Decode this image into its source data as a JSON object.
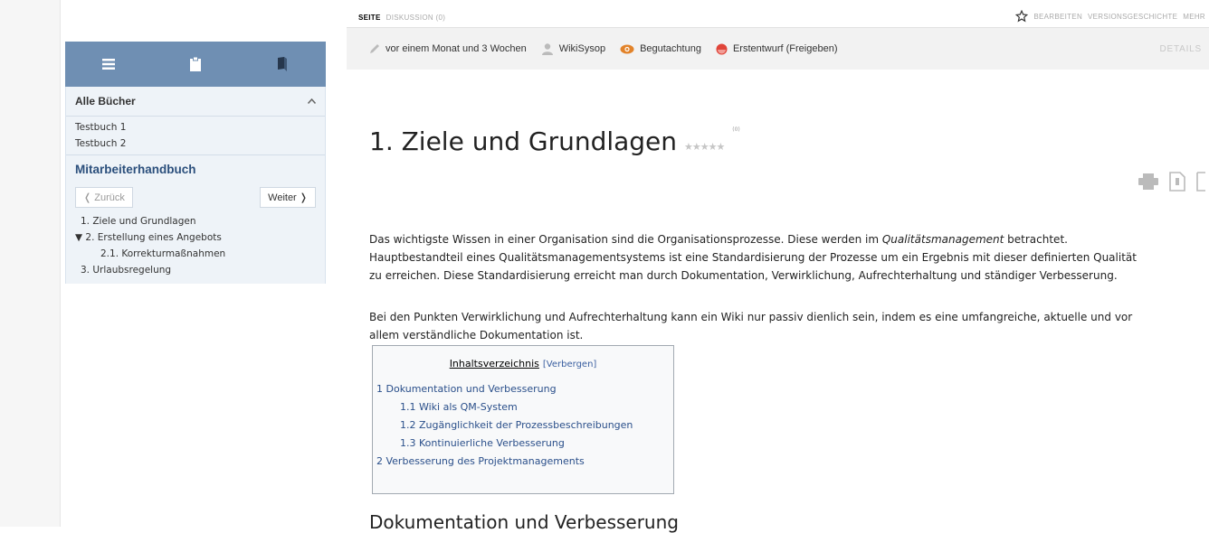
{
  "sidebar": {
    "books_header": "Alle Bücher",
    "books": [
      "Testbuch 1",
      "Testbuch 2"
    ],
    "current_book": "Mitarbeiterhandbuch",
    "back_label": "❬ Zurück",
    "next_label": "Weiter ❭",
    "chapters": [
      {
        "label": "1. Ziele und Grundlagen",
        "level": 1
      },
      {
        "label": "▼ 2. Erstellung eines Angebots",
        "level": 1
      },
      {
        "label": "2.1. Korrekturmaßnahmen",
        "level": 2
      },
      {
        "label": "3. Urlaubsregelung",
        "level": 1
      }
    ]
  },
  "tabs": {
    "page": "SEITE",
    "discussion": "DISKUSSION (0)",
    "edit": "BEARBEITEN",
    "history": "VERSIONSGESCHICHTE",
    "more": "MEHR"
  },
  "meta": {
    "time": "vor einem Monat und 3 Wochen",
    "user": "WikiSysop",
    "review": "Begutachtung",
    "status": "Erstentwurf (Freigeben)",
    "details": "DETAILS"
  },
  "page": {
    "title": "1. Ziele und Grundlagen",
    "rating_count": "(0)",
    "p1_line1_a": "Das wichtigste Wissen in einer Organisation sind die Organisationsprozesse. Diese werden im ",
    "p1_line1_em": "Qualitätsmanagement",
    "p1_line1_b": " betrachtet.",
    "p1_line2": "Hauptbestandteil eines Qualitätsmanagementsystems ist eine Standardisierung der Prozesse um ein Ergebnis mit dieser definierten Qualität",
    "p1_line3": "zu erreichen. Diese Standardisierung erreicht man durch Dokumentation, Verwirklichung, Aufrechterhaltung und ständiger Verbesserung.",
    "p2_line1": "Bei den Punkten Verwirklichung und Aufrechterhaltung kann ein Wiki nur passiv dienlich sein, indem es eine umfangreiche, aktuelle und vor",
    "p2_line2": "allem verständliche Dokumentation ist.",
    "h2": "Dokumentation und Verbesserung"
  },
  "toc": {
    "title": "Inhaltsverzeichnis",
    "hide": "[Verbergen]",
    "items": [
      {
        "label": "1 Dokumentation und Verbesserung",
        "level": 1
      },
      {
        "label": "1.1 Wiki als QM-System",
        "level": 2
      },
      {
        "label": "1.2 Zugänglichkeit der Prozessbeschreibungen",
        "level": 2
      },
      {
        "label": "1.3 Kontinuierliche Verbesserung",
        "level": 2
      },
      {
        "label": "2 Verbesserung des Projektmanagements",
        "level": 1
      }
    ]
  },
  "colors": {
    "sidebar_header": "#6f8fb3",
    "sidebar_bg": "#eef3f8",
    "link": "#2a4f8a",
    "review_icon": "#e2832a",
    "status_icon": "#e0453a"
  }
}
